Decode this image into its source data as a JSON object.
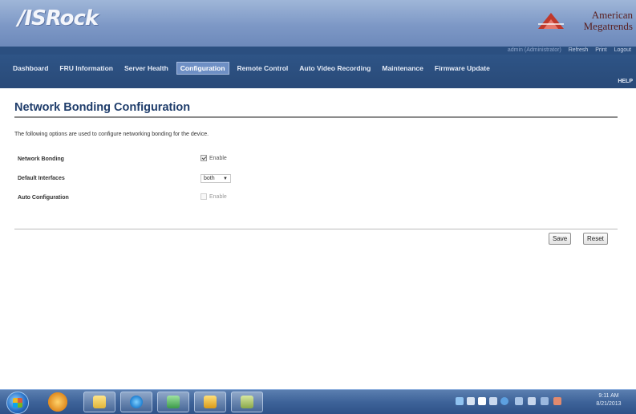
{
  "header": {
    "logo_text": "/ISRock",
    "vendor_line1": "American",
    "vendor_line2": "Megatrends",
    "vendor_color": "#b33a3a"
  },
  "toplinks": {
    "user": "admin (Administrator)",
    "refresh": "Refresh",
    "print": "Print",
    "logout": "Logout"
  },
  "nav": {
    "items": [
      {
        "label": "Dashboard"
      },
      {
        "label": "FRU Information"
      },
      {
        "label": "Server Health"
      },
      {
        "label": "Configuration"
      },
      {
        "label": "Remote Control"
      },
      {
        "label": "Auto Video Recording"
      },
      {
        "label": "Maintenance"
      },
      {
        "label": "Firmware Update"
      }
    ],
    "active_index": 3,
    "help_label": "HELP"
  },
  "page": {
    "title": "Network Bonding Configuration",
    "description": "The following options are used to configure networking bonding for the device."
  },
  "form": {
    "network_bonding": {
      "label": "Network Bonding",
      "checkbox_label": "Enable",
      "checked": true
    },
    "default_interfaces": {
      "label": "Default Interfaces",
      "selected": "both"
    },
    "auto_configuration": {
      "label": "Auto Configuration",
      "checkbox_label": "Enable",
      "checked": false,
      "disabled": true
    }
  },
  "buttons": {
    "save": "Save",
    "reset": "Reset"
  },
  "taskbar": {
    "clock_time": "9:11 AM",
    "clock_date": "8/21/2013"
  }
}
